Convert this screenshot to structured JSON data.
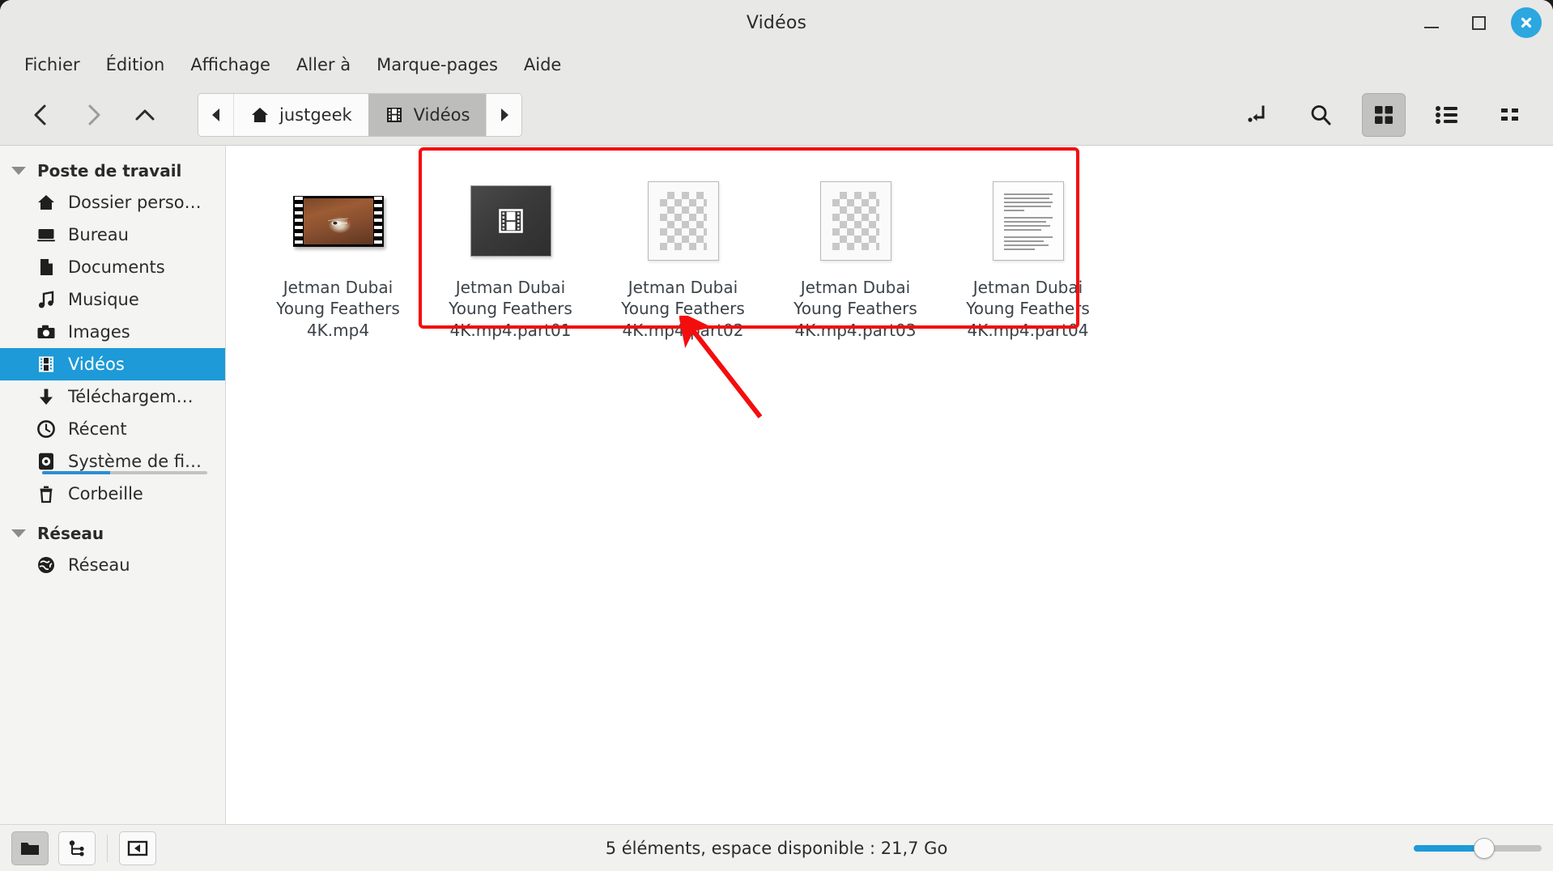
{
  "window": {
    "title": "Vidéos",
    "controls": {
      "minimize": "minimize",
      "maximize": "maximize",
      "close": "close"
    }
  },
  "menubar": {
    "items": [
      {
        "label": "Fichier"
      },
      {
        "label": "Édition"
      },
      {
        "label": "Affichage"
      },
      {
        "label": "Aller à"
      },
      {
        "label": "Marque-pages"
      },
      {
        "label": "Aide"
      }
    ]
  },
  "toolbar": {
    "back": "back-icon",
    "forward": "forward-icon",
    "up": "up-icon",
    "breadcrumb": {
      "scroll_left": "chevron-left-icon",
      "scroll_right": "chevron-right-icon",
      "crumbs": [
        {
          "label": "justgeek",
          "icon": "home-icon",
          "active": false
        },
        {
          "label": "Vidéos",
          "icon": "film-icon",
          "active": true
        }
      ]
    },
    "actions": [
      {
        "name": "open-terminal-here",
        "icon": "path-entry-icon",
        "active": false
      },
      {
        "name": "search",
        "icon": "search-icon",
        "active": false
      },
      {
        "name": "icon-view",
        "icon": "grid-view-icon",
        "active": true
      },
      {
        "name": "list-view",
        "icon": "list-view-icon",
        "active": false
      },
      {
        "name": "compact-view",
        "icon": "compact-view-icon",
        "active": false
      }
    ]
  },
  "sidebar": {
    "groups": [
      {
        "label": "Poste de travail",
        "items": [
          {
            "label": "Dossier perso…",
            "icon": "home-icon",
            "selected": false
          },
          {
            "label": "Bureau",
            "icon": "desktop-icon",
            "selected": false
          },
          {
            "label": "Documents",
            "icon": "document-icon",
            "selected": false
          },
          {
            "label": "Musique",
            "icon": "music-note-icon",
            "selected": false
          },
          {
            "label": "Images",
            "icon": "camera-icon",
            "selected": false
          },
          {
            "label": "Vidéos",
            "icon": "film-icon",
            "selected": true
          },
          {
            "label": "Téléchargem…",
            "icon": "download-arrow-icon",
            "selected": false
          },
          {
            "label": "Récent",
            "icon": "clock-icon",
            "selected": false
          },
          {
            "label": "Système de fi…",
            "icon": "drive-icon",
            "selected": false,
            "usage_percent": 41
          },
          {
            "label": "Corbeille",
            "icon": "trash-icon",
            "selected": false
          }
        ]
      },
      {
        "label": "Réseau",
        "items": [
          {
            "label": "Réseau",
            "icon": "globe-icon",
            "selected": false
          }
        ]
      }
    ]
  },
  "files": [
    {
      "name": "Jetman Dubai\nYoung Feathers\n4K.mp4",
      "thumb": "video-preview",
      "highlighted": false
    },
    {
      "name": "Jetman Dubai\nYoung Feathers\n4K.mp4.part01",
      "thumb": "video-generic",
      "highlighted": true
    },
    {
      "name": "Jetman Dubai\nYoung Feathers\n4K.mp4.part02",
      "thumb": "unknown-checker",
      "highlighted": true
    },
    {
      "name": "Jetman Dubai\nYoung Feathers\n4K.mp4.part03",
      "thumb": "unknown-checker",
      "highlighted": true
    },
    {
      "name": "Jetman Dubai\nYoung Feathers\n4K.mp4.part04",
      "thumb": "text-document",
      "highlighted": true
    }
  ],
  "annotation": {
    "box_color": "#f50d0d",
    "arrow_color": "#f50d0d",
    "target": "split-part-files"
  },
  "statusbar": {
    "buttons": [
      {
        "name": "folder-view-button",
        "icon": "folder-icon",
        "active": true
      },
      {
        "name": "tree-view-button",
        "icon": "tree-icon",
        "active": false
      },
      {
        "name": "sidebar-toggle-button",
        "icon": "panel-left-icon",
        "active": false
      }
    ],
    "text": "5 éléments, espace disponible : 21,7 Go",
    "zoom": {
      "value_percent": 55,
      "accent": "#1d9ad7"
    }
  },
  "colors": {
    "accent": "#1d9ad7",
    "chrome": "#e8e8e7",
    "sidebar_bg": "#f4f4f3",
    "content_bg": "#ffffff",
    "text": "#2b2b2b"
  }
}
